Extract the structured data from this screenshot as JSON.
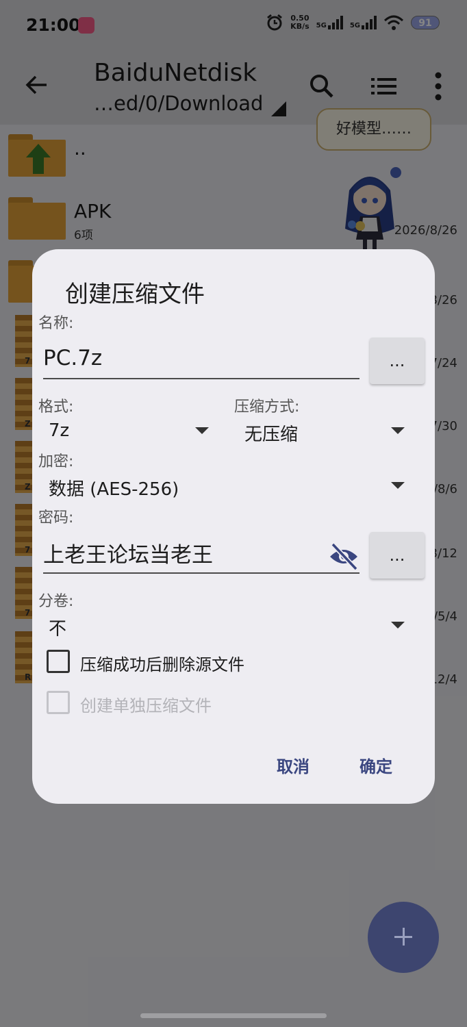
{
  "status_bar": {
    "time": "21:00",
    "net_speed_value": "0.50",
    "net_speed_unit": "KB/s",
    "sig1": "5G",
    "sig2": "5G",
    "battery": "91"
  },
  "toolbar": {
    "title": "BaiduNetdisk",
    "path": "…ed/0/Download"
  },
  "file_list": {
    "parent": "..",
    "apk_name": "APK",
    "apk_count": "6项",
    "apk_date": "2026/8/26",
    "partial_dates": [
      "3/26",
      "7/24",
      "7/30",
      "/8/6",
      "3/12",
      "/5/4",
      "12/4"
    ],
    "zip_letters": [
      "7",
      "Z",
      "Z",
      "7",
      "7",
      "R"
    ]
  },
  "bubble": "好模型……",
  "dialog": {
    "title": "创建压缩文件",
    "name_label": "名称:",
    "name_value": "PC.7z",
    "browse_label": "...",
    "format_label": "格式:",
    "format_value": "7z",
    "method_label": "压缩方式:",
    "method_value": "无压缩",
    "encrypt_label": "加密:",
    "encrypt_value": "数据 (AES-256)",
    "password_label": "密码:",
    "password_value": "上老王论坛当老王",
    "split_label": "分卷:",
    "split_value": "不",
    "delete_source_label": "压缩成功后删除源文件",
    "separate_archives_label": "创建单独压缩文件",
    "cancel_label": "取消",
    "ok_label": "确定"
  }
}
